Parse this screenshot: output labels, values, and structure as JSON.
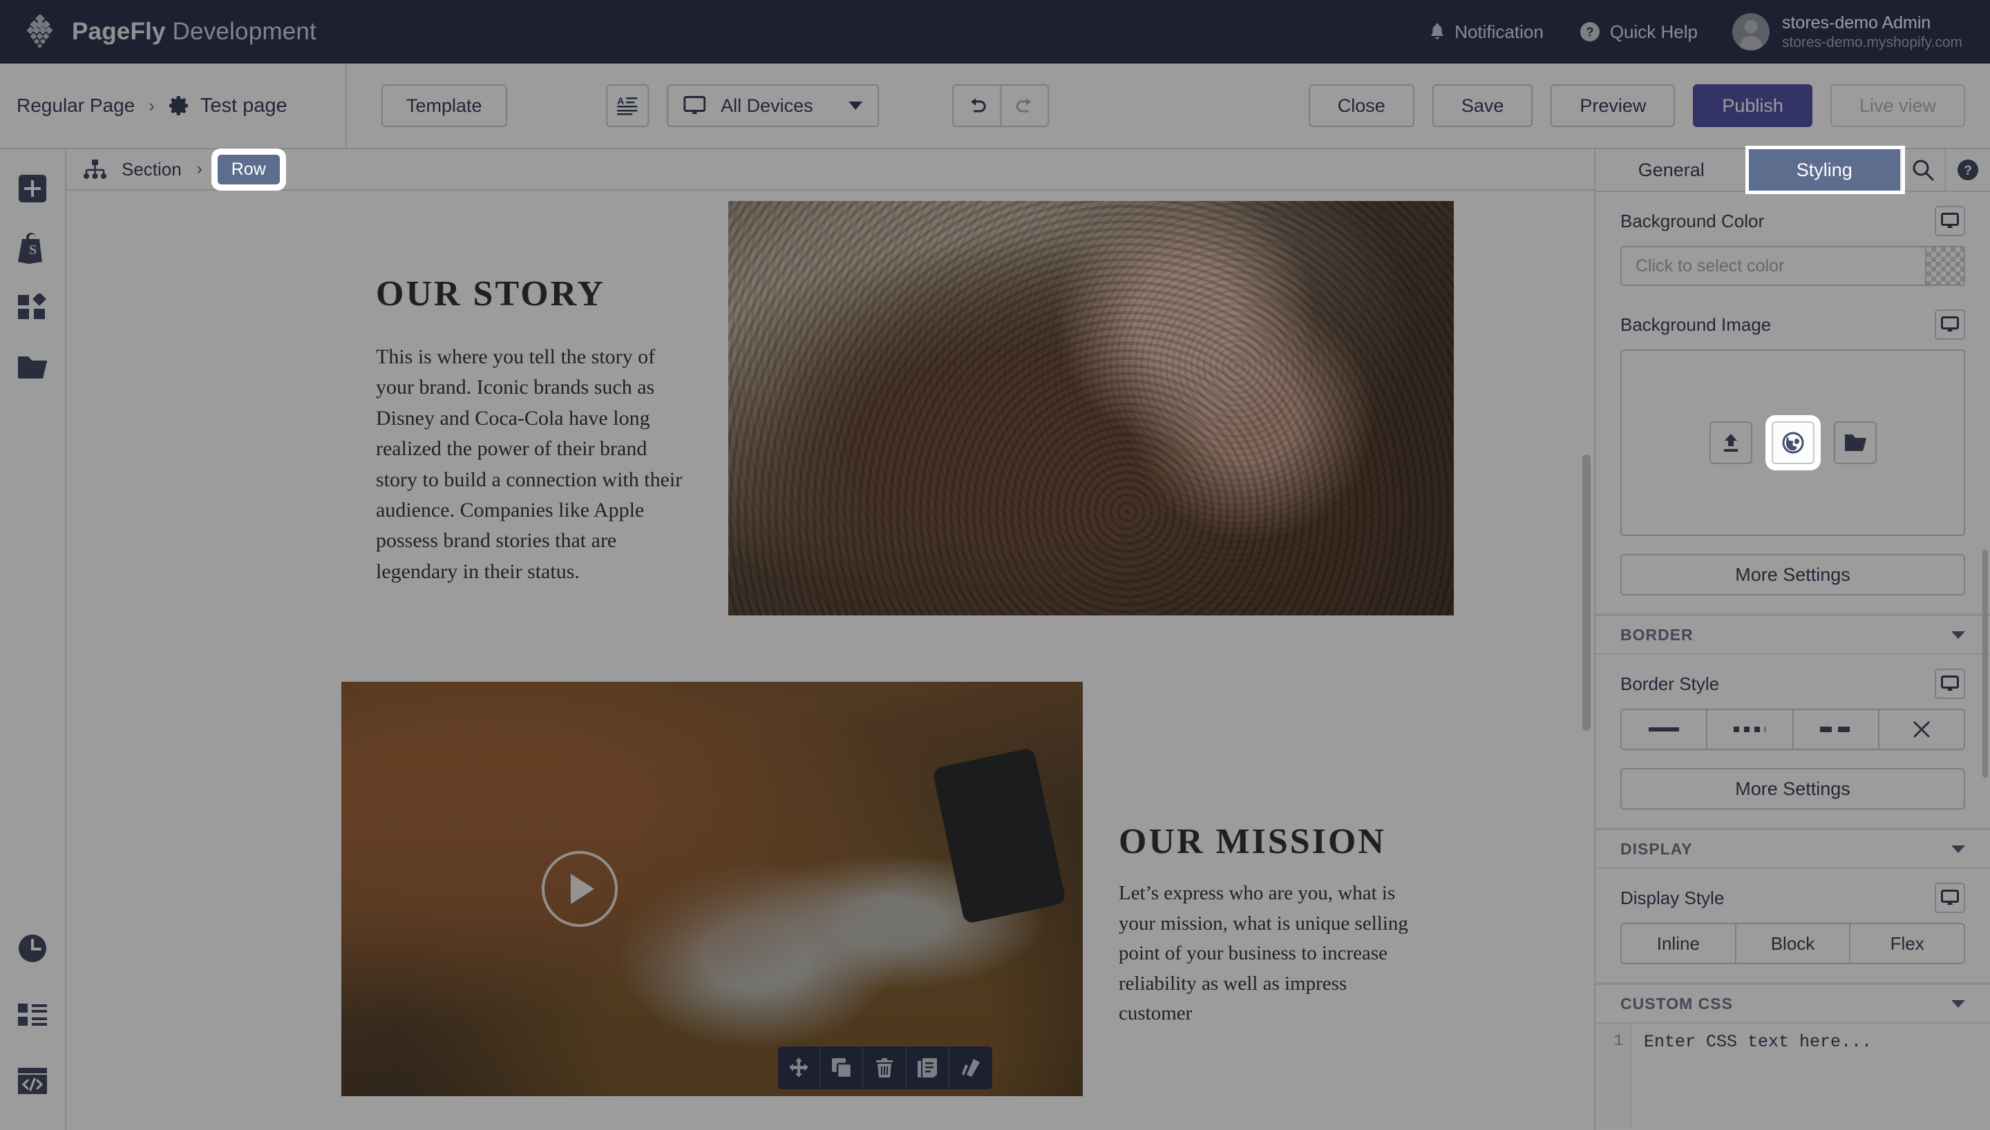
{
  "topbar": {
    "brand_bold": "PageFly",
    "brand_light": " Development",
    "logo_icon": "pagefly-diamond-logo",
    "notification_label": "Notification",
    "notification_icon": "bell-icon",
    "quick_help_label": "Quick Help",
    "quick_help_icon": "question-circle-icon",
    "user_name": "stores-demo Admin",
    "user_shop": "stores-demo.myshopify.com",
    "brand_bg": "#151a3a"
  },
  "toolbar": {
    "breadcrumb_root": "Regular Page",
    "breadcrumb_sep": "›",
    "page_name": "Test page",
    "page_gear_icon": "gear-icon",
    "template_label": "Template",
    "text_format_icon": "text-format-icon",
    "device_icon": "desktop-icon",
    "device_label": "All Devices",
    "undo_icon": "undo-arrow-icon",
    "redo_icon": "redo-arrow-icon",
    "close_label": "Close",
    "save_label": "Save",
    "preview_label": "Preview",
    "publish_label": "Publish",
    "live_view_label": "Live view",
    "publish_color": "#3d3d9e"
  },
  "rail": {
    "items": [
      {
        "icon": "plus-square-icon",
        "name": "add-element"
      },
      {
        "icon": "shopify-bag-icon",
        "name": "shopify-elements"
      },
      {
        "icon": "grid-shapes-icon",
        "name": "sections-library"
      },
      {
        "icon": "folder-icon",
        "name": "assets-folder"
      }
    ],
    "bottom_items": [
      {
        "icon": "clock-icon",
        "name": "version-history"
      },
      {
        "icon": "list-icon",
        "name": "layers-list"
      },
      {
        "icon": "code-window-icon",
        "name": "custom-code"
      }
    ]
  },
  "crumbbar": {
    "tree_icon": "sitemap-icon",
    "section_label": "Section",
    "arrow": "›",
    "row_label": "Row"
  },
  "canvas": {
    "story": {
      "heading": "OUR STORY",
      "paragraph": "This is where you tell the story of your brand. Iconic brands such as Disney and Coca-Cola have long realized the power of their brand story to build a connection with their audience. Companies like Apple possess brand stories that are legendary in their status.",
      "image_alt": "hand-holding-coffee-beans-over-bowl"
    },
    "mission": {
      "heading": "OUR MISSION",
      "paragraph": "Let’s express who are you, what is your mission, what is unique selling point of your business to increase reliability as well as impress customer",
      "video_alt": "person-holding-coffee-cup-on-wooden-table",
      "play_icon": "play-circle-icon"
    },
    "element_toolbar": [
      {
        "icon": "move-arrows-icon",
        "name": "move-element"
      },
      {
        "icon": "duplicate-icon",
        "name": "duplicate-element"
      },
      {
        "icon": "trash-icon",
        "name": "delete-element"
      },
      {
        "icon": "save-library-icon",
        "name": "save-to-library"
      },
      {
        "icon": "palette-icon",
        "name": "style-element"
      }
    ]
  },
  "panel": {
    "tabs": [
      {
        "label": "General",
        "active": false
      },
      {
        "label": "Styling",
        "active": true
      }
    ],
    "search_icon": "search-icon",
    "help_icon": "question-circle-icon",
    "background_color": {
      "label": "Background Color",
      "placeholder": "Click to select color",
      "device_icon": "desktop-icon",
      "swatch_icon": "transparent-checker-swatch"
    },
    "background_image": {
      "label": "Background Image",
      "device_icon": "desktop-icon",
      "buttons": [
        {
          "icon": "upload-icon",
          "name": "upload-image-button",
          "highlighted": false
        },
        {
          "icon": "globe-icon",
          "name": "image-from-url-button",
          "highlighted": true
        },
        {
          "icon": "folder-open-icon",
          "name": "browse-library-button",
          "highlighted": false
        }
      ],
      "more_settings_label": "More Settings"
    },
    "border": {
      "section_title": "BORDER",
      "style_label": "Border Style",
      "device_icon": "desktop-icon",
      "options": [
        {
          "name": "border-solid",
          "glyph": "solid"
        },
        {
          "name": "border-dotted",
          "glyph": "dotted"
        },
        {
          "name": "border-dashed",
          "glyph": "dashed"
        },
        {
          "name": "border-none",
          "glyph": "none"
        }
      ],
      "more_settings_label": "More Settings"
    },
    "display": {
      "section_title": "DISPLAY",
      "style_label": "Display Style",
      "device_icon": "desktop-icon",
      "options": [
        "Inline",
        "Block",
        "Flex"
      ]
    },
    "custom_css": {
      "section_title": "CUSTOM CSS",
      "line_number": "1",
      "placeholder": "Enter CSS text here..."
    }
  }
}
